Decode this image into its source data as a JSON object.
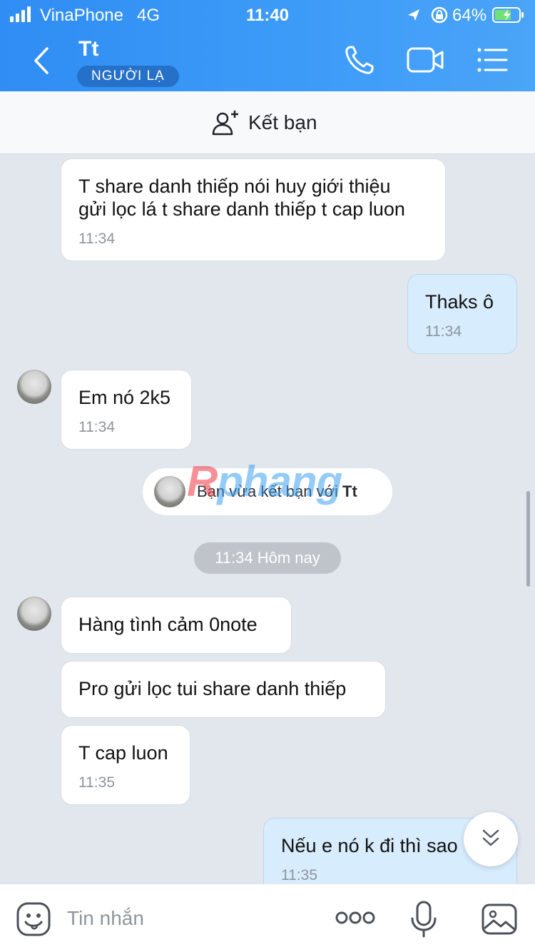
{
  "status_bar": {
    "carrier": "VinaPhone",
    "network": "4G",
    "time": "11:40",
    "battery_percent": "64%"
  },
  "header": {
    "title": "Tt",
    "badge": "NGƯỜI LẠ",
    "icons": [
      "back-icon",
      "phone-icon",
      "video-call-icon",
      "menu-icon"
    ]
  },
  "add_friend": {
    "label": "Kết bạn",
    "icon": "add-user-icon"
  },
  "messages": [
    {
      "from": "them",
      "text": "T share danh thiếp nói huy giới thiệu\ngửi lọc lá t share danh thiếp t cap luon",
      "time": "11:34"
    },
    {
      "from": "me",
      "text": "Thaks ô",
      "time": "11:34"
    },
    {
      "from": "them",
      "text": "Em nó 2k5",
      "time": "11:34"
    },
    {
      "from": "them",
      "text": "Hàng tình cảm 0note",
      "time": ""
    },
    {
      "from": "them",
      "text": "Pro gửi lọc tui share danh thiếp",
      "time": ""
    },
    {
      "from": "them",
      "text": "T cap luon",
      "time": "11:35"
    },
    {
      "from": "me",
      "text": "Nếu e nó k đi thì sao",
      "time": "11:35"
    }
  ],
  "system_message": {
    "prefix": "Bạn vừa kết bạn với ",
    "name": "Tt"
  },
  "watermark": {
    "first": "R",
    "rest": "phang"
  },
  "date_chip": "11:34 Hôm nay",
  "input": {
    "placeholder": "Tin nhắn",
    "value": ""
  }
}
